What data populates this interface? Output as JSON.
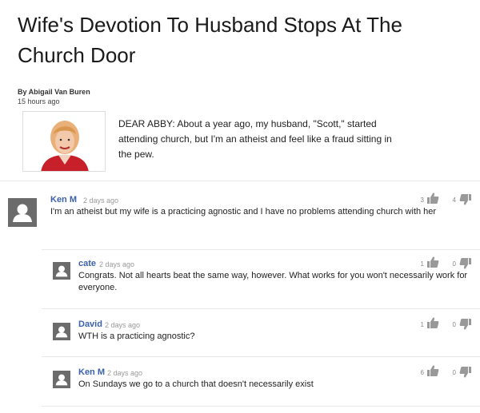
{
  "article": {
    "title": "Wife's Devotion To Husband Stops At The Church Door",
    "byline": "By Abigail Van Buren",
    "time": "15 hours ago",
    "excerpt": "DEAR ABBY: About a year ago, my husband, \"Scott,\" started attending church, but I'm an atheist and feel like a fraud sitting in the pew."
  },
  "comments": [
    {
      "author": "Ken M",
      "time": "2 days ago",
      "body": "I'm an atheist but my wife is a practicing agnostic and I have no problems attending church with her",
      "up": "3",
      "down": "4"
    },
    {
      "author": "cate",
      "time": "2 days ago",
      "body": "Congrats. Not all hearts beat the same way, however. What works for you won't necessarily work for everyone.",
      "up": "1",
      "down": "0"
    },
    {
      "author": "David",
      "time": "2 days ago",
      "body": "WTH is a practicing agnostic?",
      "up": "1",
      "down": "0"
    },
    {
      "author": "Ken M",
      "time": "2 days ago",
      "body": "On Sundays we go to a church that doesn't necessarily exist",
      "up": "6",
      "down": "0"
    }
  ],
  "colors": {
    "author_link": "#3b61a8",
    "thumb": "#999999",
    "avatar_bg": "#6b6b6b"
  },
  "icons": {
    "avatar": "user-silhouette-icon",
    "up": "thumbs-up-icon",
    "down": "thumbs-down-icon"
  }
}
